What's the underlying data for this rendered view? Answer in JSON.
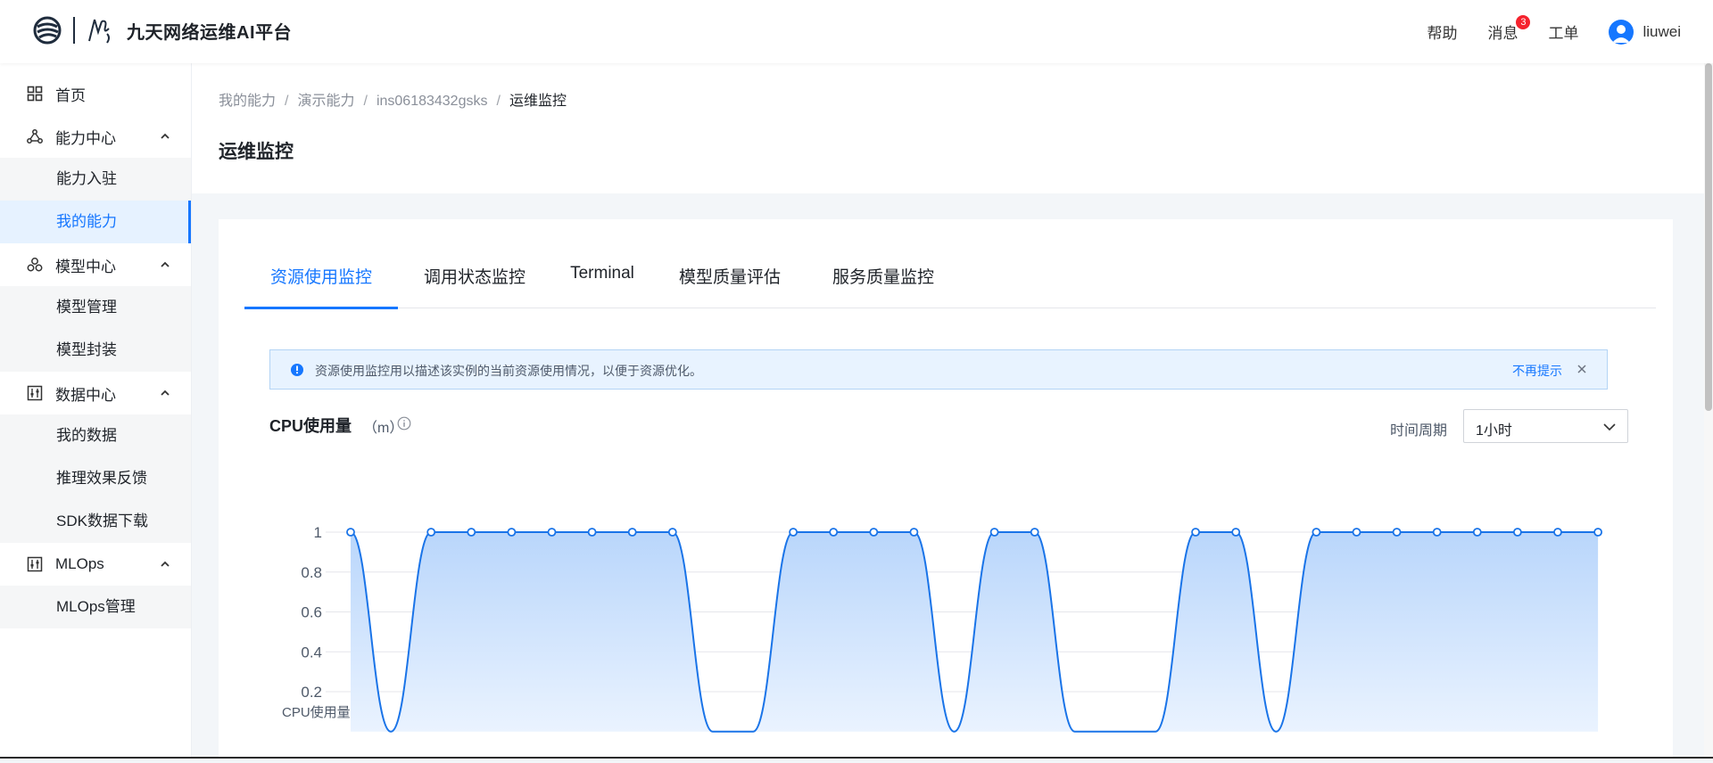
{
  "header": {
    "brand_title": "九天网络运维AI平台",
    "help": "帮助",
    "messages": "消息",
    "message_count": "3",
    "tickets": "工单",
    "username": "liuwei"
  },
  "sidebar": {
    "items": [
      {
        "label": "首页",
        "icon": "grid-icon"
      },
      {
        "label": "能力中心",
        "icon": "nodes-icon",
        "children": [
          "能力入驻",
          "我的能力"
        ]
      },
      {
        "label": "模型中心",
        "icon": "cluster-icon",
        "children": [
          "模型管理",
          "模型封装"
        ]
      },
      {
        "label": "数据中心",
        "icon": "sliders-icon",
        "children": [
          "我的数据",
          "推理效果反馈",
          "SDK数据下载"
        ]
      },
      {
        "label": "MLOps",
        "icon": "sliders-icon",
        "children": [
          "MLOps管理"
        ]
      }
    ],
    "active_child": "我的能力"
  },
  "breadcrumb": [
    "我的能力",
    "演示能力",
    "ins06183432gsks",
    "运维监控"
  ],
  "page_title": "运维监控",
  "tabs": [
    "资源使用监控",
    "调用状态监控",
    "Terminal",
    "模型质量评估",
    "服务质量监控"
  ],
  "active_tab": "资源使用监控",
  "alert": {
    "text": "资源使用监控用以描述该实例的当前资源使用情况，以便于资源优化。",
    "dismiss": "不再提示"
  },
  "metric": {
    "title": "CPU使用量",
    "unit": "（m）",
    "period_label": "时间周期",
    "period_value": "1小时"
  },
  "colors": {
    "accent": "#1677ff",
    "line": "#1a74e8",
    "fill_top": "#b9d6fb",
    "fill_bottom": "#eaf3ff"
  },
  "chart_data": {
    "type": "area",
    "ylabel": "CPU使用量",
    "yticks": [
      1,
      0.8,
      0.6,
      0.4,
      0.2
    ],
    "ylim": [
      0,
      1
    ],
    "grid": true,
    "x": [
      0,
      1,
      2,
      3,
      4,
      5,
      6,
      7,
      8,
      9,
      10,
      11,
      12,
      13,
      14,
      15,
      16,
      17,
      18,
      19,
      20,
      21,
      22,
      23,
      24,
      25,
      26,
      27,
      28,
      29,
      30,
      31
    ],
    "values": [
      1,
      0,
      1,
      1,
      1,
      1,
      1,
      1,
      1,
      0,
      0,
      1,
      1,
      1,
      1,
      0,
      1,
      1,
      0,
      0,
      0,
      1,
      1,
      0,
      1,
      1,
      1,
      1,
      1,
      1,
      1,
      1
    ]
  }
}
